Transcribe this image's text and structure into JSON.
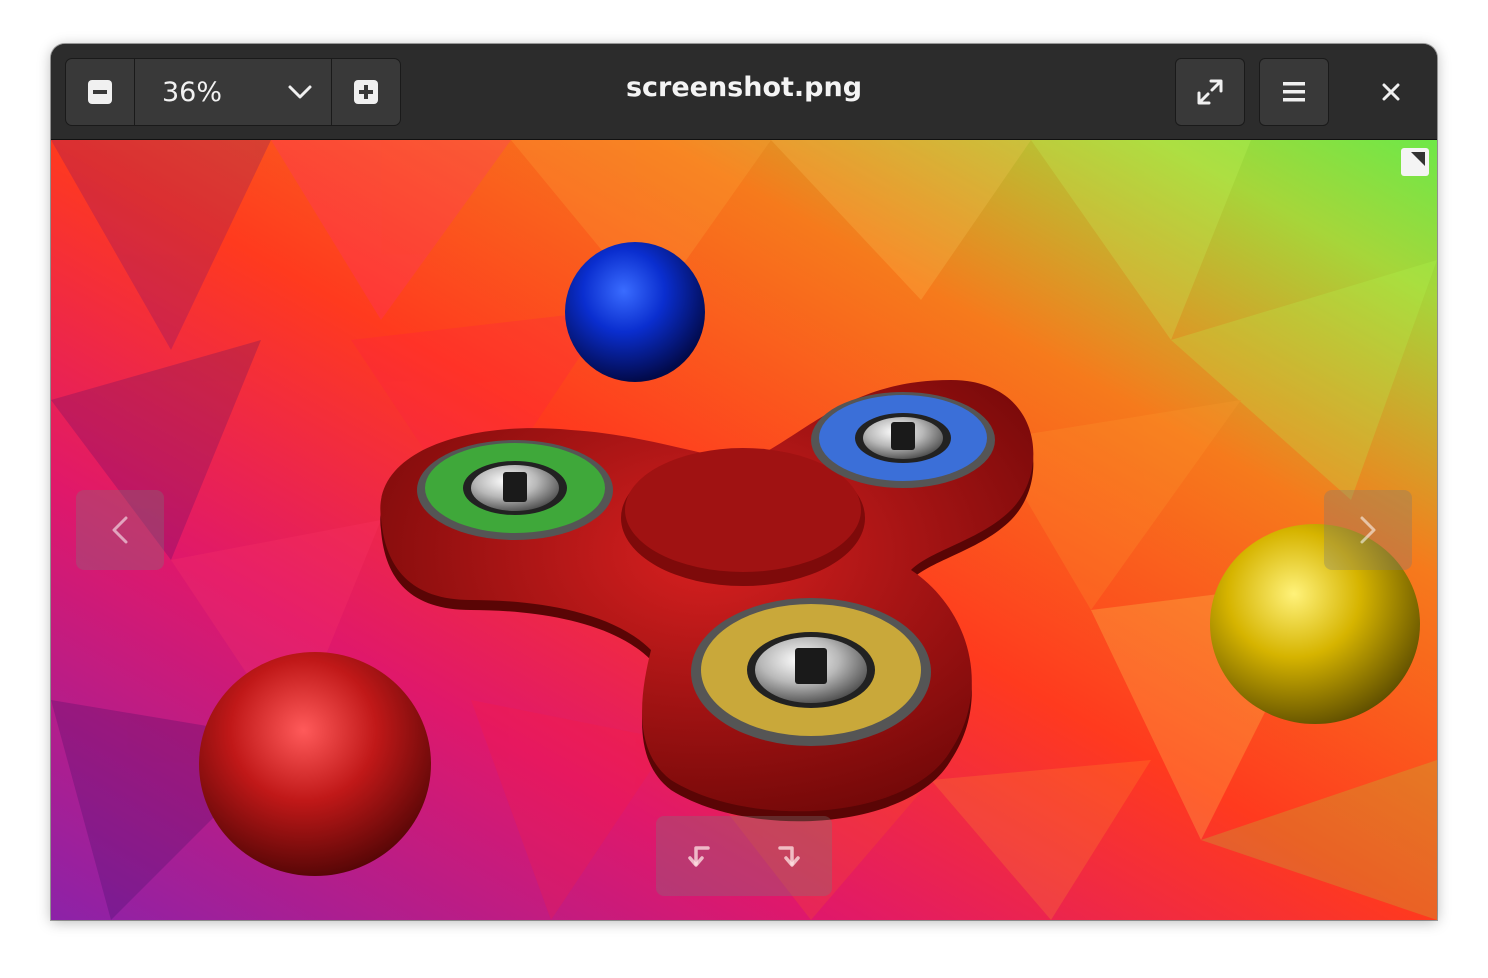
{
  "window": {
    "title": "screenshot.png"
  },
  "zoom": {
    "level": "36%"
  },
  "icons": {
    "zoom_out": "zoom-out-minus-icon",
    "zoom_level_dropdown": "chevron-down-icon",
    "zoom_in": "zoom-in-plus-icon",
    "fullscreen": "fullscreen-arrows-icon",
    "menu": "hamburger-menu-icon",
    "close": "close-icon",
    "previous": "chevron-left-icon",
    "next": "chevron-right-icon",
    "rotate_left": "rotate-left-icon",
    "rotate_right": "rotate-right-icon"
  },
  "colors": {
    "headerbar": "#2c2c2c",
    "button": "#393939",
    "title_text": "#f4f4f4",
    "fidget_spinner": "#b01616",
    "bearing_green": "#3fa83a",
    "bearing_blue": "#3b6fd8",
    "bearing_yellow": "#c9a83a",
    "sphere_blue": "#0a2ecf",
    "sphere_red": "#c01818",
    "sphere_gold": "#d6b400"
  }
}
